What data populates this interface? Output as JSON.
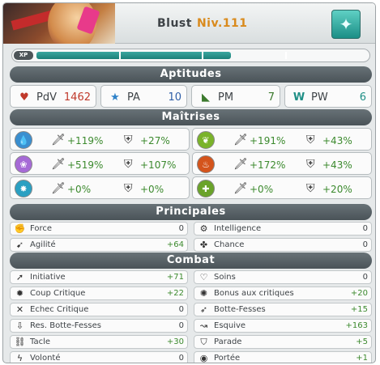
{
  "header": {
    "name": "Blust",
    "level": "Niv.111",
    "class_icon": "sadida-class-icon"
  },
  "xp": {
    "label": "XP",
    "progress": 0.59
  },
  "sections": {
    "aptitudes": "Aptitudes",
    "maitrises": "Maîtrises",
    "principales": "Principales",
    "combat": "Combat"
  },
  "aptitudes": [
    {
      "label": "PdV",
      "value": "1462",
      "icon": "heart-icon",
      "color": "#c0392b"
    },
    {
      "label": "PA",
      "value": "10",
      "icon": "star-icon",
      "color": "#2f5fa8"
    },
    {
      "label": "PM",
      "value": "7",
      "icon": "boot-icon",
      "color": "#3c7a2e"
    },
    {
      "label": "PW",
      "value": "6",
      "icon": "wakfu-icon",
      "color": "#1f8f86"
    }
  ],
  "maitrises": [
    {
      "element": "water",
      "icon": "water-icon",
      "color": "#3a8fd0",
      "mastery": "+119%",
      "resistance": "+27%"
    },
    {
      "element": "earth",
      "icon": "earth-icon",
      "color": "#7ab32a",
      "mastery": "+191%",
      "resistance": "+43%"
    },
    {
      "element": "air",
      "icon": "air-icon",
      "color": "#a66ad6",
      "mastery": "+519%",
      "resistance": "+107%"
    },
    {
      "element": "fire",
      "icon": "fire-icon",
      "color": "#d4541c",
      "mastery": "+172%",
      "resistance": "+43%"
    },
    {
      "element": "stasis",
      "icon": "stasis-icon",
      "color": "#2aa0c2",
      "mastery": "+0%",
      "resistance": "+0%"
    },
    {
      "element": "support",
      "icon": "support-icon",
      "color": "#6aa32a",
      "mastery": "+0%",
      "resistance": "+20%"
    }
  ],
  "principales": [
    {
      "label": "Force",
      "value": "0",
      "icon": "fist-icon"
    },
    {
      "label": "Intelligence",
      "value": "0",
      "icon": "brain-icon"
    },
    {
      "label": "Agilité",
      "value": "+64",
      "icon": "agility-icon"
    },
    {
      "label": "Chance",
      "value": "0",
      "icon": "clover-icon"
    }
  ],
  "combat": [
    {
      "label": "Initiative",
      "value": "+71",
      "icon": "initiative-icon"
    },
    {
      "label": "Soins",
      "value": "0",
      "icon": "heal-icon"
    },
    {
      "label": "Coup Critique",
      "value": "+22",
      "icon": "critical-icon"
    },
    {
      "label": "Bonus aux critiques",
      "value": "+20",
      "icon": "critical-bonus-icon"
    },
    {
      "label": "Echec Critique",
      "value": "0",
      "icon": "critical-fail-icon"
    },
    {
      "label": "Botte-Fesses",
      "value": "+15",
      "icon": "kick-icon"
    },
    {
      "label": "Res. Botte-Fesses",
      "value": "0",
      "icon": "kick-res-icon"
    },
    {
      "label": "Esquive",
      "value": "+163",
      "icon": "dodge-icon"
    },
    {
      "label": "Tacle",
      "value": "+30",
      "icon": "tackle-icon"
    },
    {
      "label": "Parade",
      "value": "+5",
      "icon": "parry-icon"
    },
    {
      "label": "Volonté",
      "value": "0",
      "icon": "willpower-icon"
    },
    {
      "label": "Portée",
      "value": "+1",
      "icon": "range-icon"
    }
  ]
}
